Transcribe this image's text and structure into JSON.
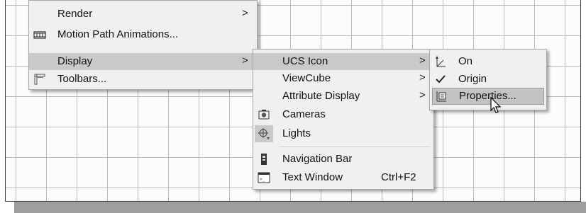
{
  "menu1": {
    "items": [
      {
        "label": "Render",
        "arrow": ">"
      },
      {
        "label": "Motion Path Animations...",
        "icon": "film-strip-icon"
      },
      {
        "label": "Display",
        "arrow": ">"
      },
      {
        "label": "Toolbars...",
        "icon": "toolbars-icon"
      }
    ]
  },
  "menu2": {
    "items": [
      {
        "label": "UCS Icon",
        "arrow": ">"
      },
      {
        "label": "ViewCube",
        "arrow": ">"
      },
      {
        "label": "Attribute Display",
        "arrow": ">"
      },
      {
        "label": "Cameras",
        "icon": "camera-icon"
      },
      {
        "label": "Lights",
        "icon": "light-target-icon"
      },
      {
        "label": "Navigation Bar",
        "icon": "navigation-bar-icon"
      },
      {
        "label": "Text Window",
        "icon": "text-window-icon",
        "shortcut": "Ctrl+F2"
      }
    ]
  },
  "menu3": {
    "items": [
      {
        "label": "On",
        "icon": "ucs-axes-icon"
      },
      {
        "label": "Origin",
        "icon": "checkmark-icon"
      },
      {
        "label": "Properties...",
        "icon": "ucs-properties-icon"
      }
    ]
  },
  "colors": {
    "highlight": "#c9c9c9",
    "menu_bg": "#f0f0f0",
    "grid": "#b9b9b9"
  }
}
